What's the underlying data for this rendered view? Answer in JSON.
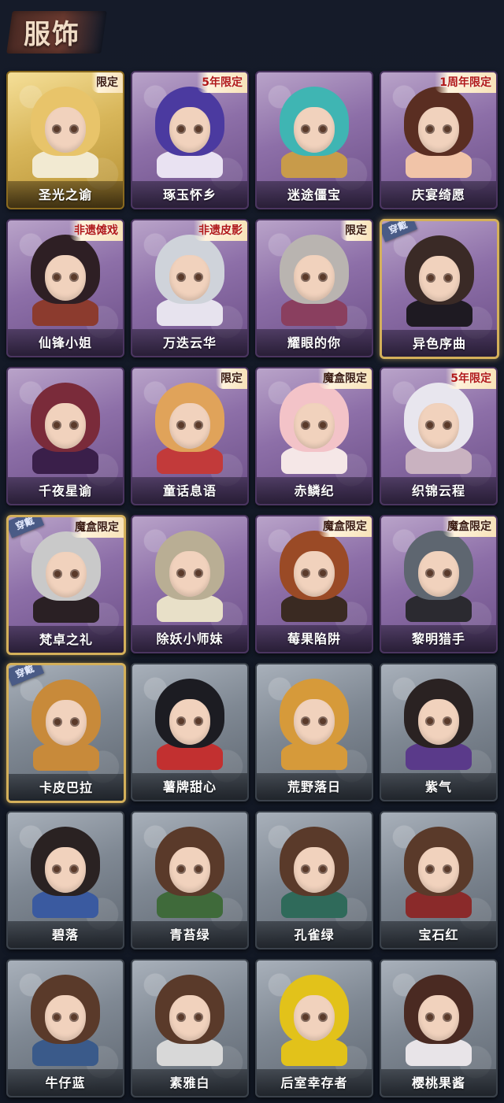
{
  "header": {
    "title": "服饰"
  },
  "worn_label": "穿戴",
  "items": [
    {
      "name": "圣光之谕",
      "tag": "限定",
      "style": "gold",
      "worn": false,
      "hair": "#e8c46a",
      "body": "#f2ead2"
    },
    {
      "name": "琢玉怀乡",
      "tag": "5年限定",
      "style": "purple",
      "worn": false,
      "hair": "#4b3aa0",
      "body": "#e9e2f2"
    },
    {
      "name": "迷途僵宝",
      "tag": "",
      "style": "purple",
      "worn": false,
      "hair": "#3fb5b3",
      "body": "#c89b4a"
    },
    {
      "name": "庆宴绮愿",
      "tag": "1周年限定",
      "style": "purple",
      "worn": false,
      "hair": "#5a2e22",
      "body": "#f1c4a8"
    },
    {
      "name": "仙锋小姐",
      "tag": "非遗傩戏",
      "style": "purple",
      "worn": false,
      "hair": "#2e1f24",
      "body": "#8c3b2e"
    },
    {
      "name": "万迭云华",
      "tag": "非遗皮影",
      "style": "purple",
      "worn": false,
      "hair": "#cfd3da",
      "body": "#e7e3ee"
    },
    {
      "name": "耀眼的你",
      "tag": "限定",
      "style": "purple",
      "worn": false,
      "hair": "#b9b4b0",
      "body": "#8a3f5f"
    },
    {
      "name": "异色序曲",
      "tag": "",
      "style": "purple",
      "worn": true,
      "hair": "#3a2a26",
      "body": "#1e1a22"
    },
    {
      "name": "千夜星谕",
      "tag": "",
      "style": "purple",
      "worn": false,
      "hair": "#7a2b3a",
      "body": "#3a1f4a"
    },
    {
      "name": "童话息语",
      "tag": "限定",
      "style": "purple",
      "worn": false,
      "hair": "#e0a35a",
      "body": "#c23a3a"
    },
    {
      "name": "赤鳞纪",
      "tag": "魔盒限定",
      "style": "purple",
      "worn": false,
      "hair": "#f3c3c8",
      "body": "#f5e7e7"
    },
    {
      "name": "织锦云程",
      "tag": "5年限定",
      "style": "purple",
      "worn": false,
      "hair": "#e8e6ee",
      "body": "#c9b2c0"
    },
    {
      "name": "梵卓之礼",
      "tag": "魔盒限定",
      "style": "purple",
      "worn": true,
      "hair": "#c9c9c9",
      "body": "#2a2024"
    },
    {
      "name": "除妖小师妹",
      "tag": "",
      "style": "purple",
      "worn": false,
      "hair": "#b9ae94",
      "body": "#e8e0c8"
    },
    {
      "name": "莓果陷阱",
      "tag": "魔盒限定",
      "style": "purple",
      "worn": false,
      "hair": "#9a4a26",
      "body": "#3a2a22"
    },
    {
      "name": "黎明猎手",
      "tag": "魔盒限定",
      "style": "purple",
      "worn": false,
      "hair": "#5e6670",
      "body": "#2b2a30"
    },
    {
      "name": "卡皮巴拉",
      "tag": "",
      "style": "grey",
      "worn": true,
      "hair": "#c88a3a",
      "body": "#c88a3a"
    },
    {
      "name": "薯牌甜心",
      "tag": "",
      "style": "grey",
      "worn": false,
      "hair": "#1c1c22",
      "body": "#c23030"
    },
    {
      "name": "荒野落日",
      "tag": "",
      "style": "grey",
      "worn": false,
      "hair": "#d69a3a",
      "body": "#d69a3a"
    },
    {
      "name": "紫气",
      "tag": "",
      "style": "grey",
      "worn": false,
      "hair": "#2a2222",
      "body": "#5a3a8a"
    },
    {
      "name": "碧落",
      "tag": "",
      "style": "grey",
      "worn": false,
      "hair": "#2a2222",
      "body": "#3a5aa0"
    },
    {
      "name": "青苔绿",
      "tag": "",
      "style": "grey",
      "worn": false,
      "hair": "#5a3a2a",
      "body": "#3f6a3a"
    },
    {
      "name": "孔雀绿",
      "tag": "",
      "style": "grey",
      "worn": false,
      "hair": "#5a3a2a",
      "body": "#2f6a5a"
    },
    {
      "name": "宝石红",
      "tag": "",
      "style": "grey",
      "worn": false,
      "hair": "#5a3a2a",
      "body": "#8a2a2a"
    },
    {
      "name": "牛仔蓝",
      "tag": "",
      "style": "grey",
      "worn": false,
      "hair": "#5a3a2a",
      "body": "#3a5a8a"
    },
    {
      "name": "素雅白",
      "tag": "",
      "style": "grey",
      "worn": false,
      "hair": "#5a3a2a",
      "body": "#d8d8d8"
    },
    {
      "name": "后室幸存者",
      "tag": "",
      "style": "grey",
      "worn": false,
      "hair": "#e2c21a",
      "body": "#e2c21a"
    },
    {
      "name": "樱桃果酱",
      "tag": "",
      "style": "grey",
      "worn": false,
      "hair": "#4a2a22",
      "body": "#e8e4e8"
    }
  ]
}
